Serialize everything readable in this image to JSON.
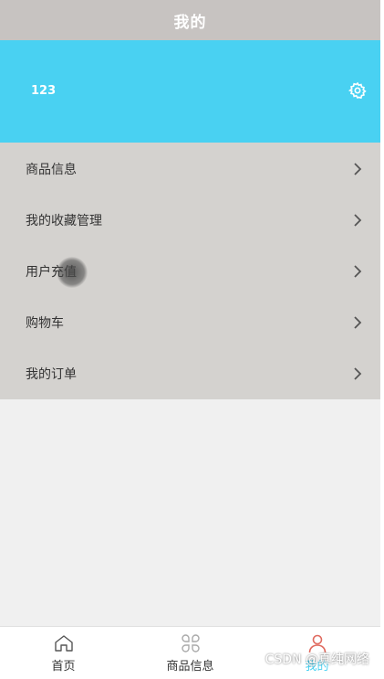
{
  "header": {
    "title": "我的"
  },
  "profile": {
    "username": "123"
  },
  "menu": {
    "items": [
      {
        "label": "商品信息"
      },
      {
        "label": "我的收藏管理"
      },
      {
        "label": "用户充值"
      },
      {
        "label": "购物车"
      },
      {
        "label": "我的订单"
      }
    ]
  },
  "bottom_nav": {
    "items": [
      {
        "label": "首页",
        "icon": "home-icon"
      },
      {
        "label": "商品信息",
        "icon": "grid-icon"
      },
      {
        "label": "我的",
        "icon": "user-icon"
      }
    ]
  },
  "watermark": "CSDN @真纯网络",
  "colors": {
    "header_bg": "#c7c3c1",
    "profile_bg": "#49d1f2",
    "menu_bg": "#d4d2cf",
    "active_nav": "#e06a5f"
  }
}
